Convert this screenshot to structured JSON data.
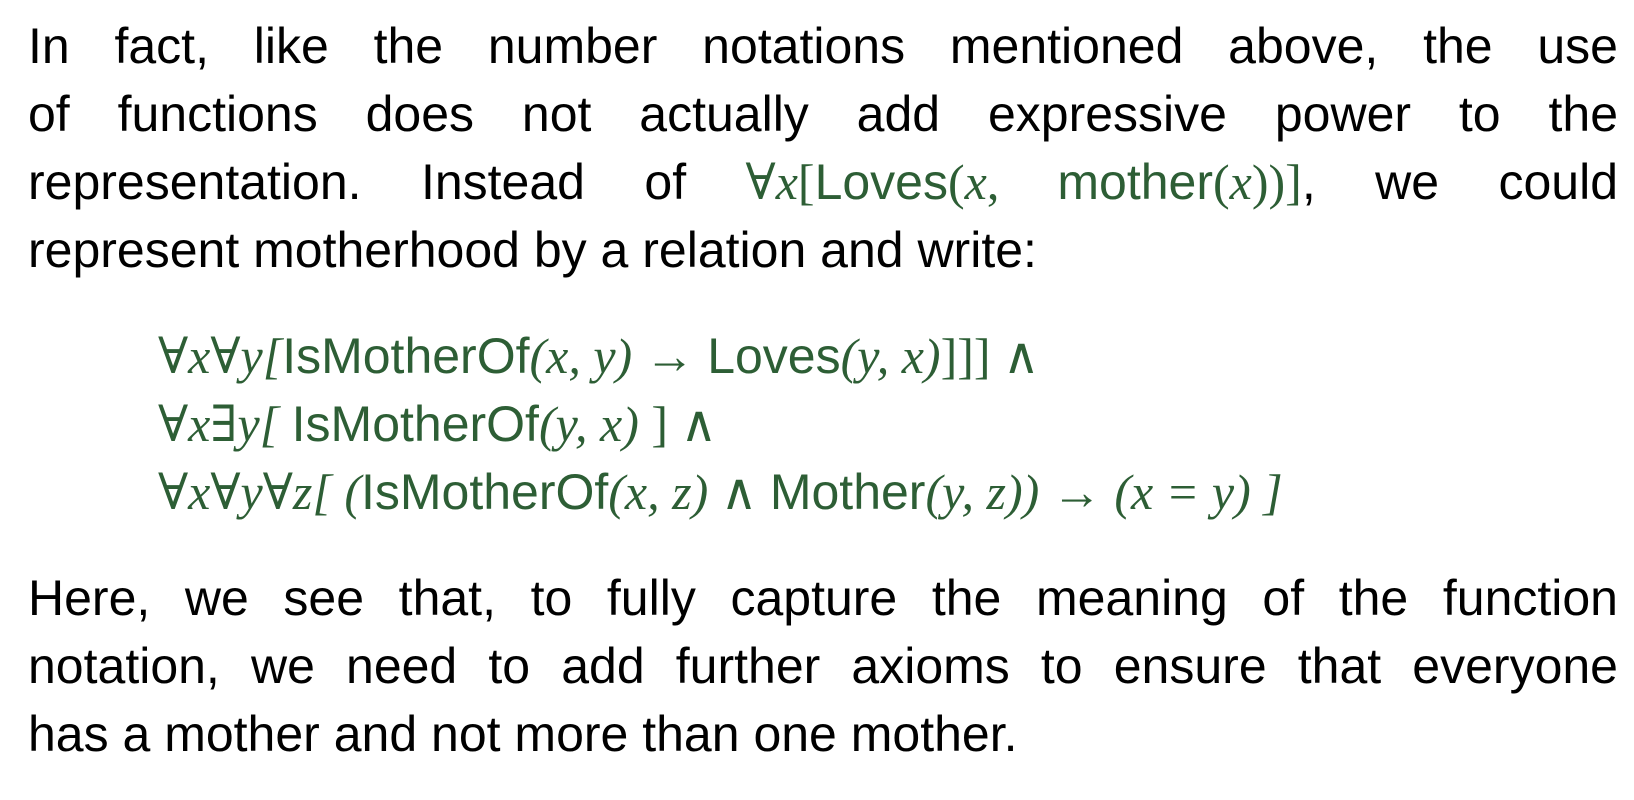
{
  "paragraph1": {
    "line1": "In fact, like the number notations mentioned above, the use",
    "line2": "of functions does not actually add expressive power to the",
    "line3_before": "representation.   Instead of ",
    "inline_formula": {
      "forall": "∀",
      "var_x": "x",
      "open": "[",
      "fn_loves": "Loves",
      "paren_open": "(",
      "arg_x": "x",
      "comma": ", ",
      "fn_mother": "mother",
      "inner_open": "(",
      "inner_x": "x",
      "close": "))]"
    },
    "line3_after": ", we could",
    "line4": "represent motherhood by a relation and write:"
  },
  "display": {
    "line1": {
      "quant": "∀x∀y[",
      "p1": "IsMotherOf",
      "a1": "(x, y)",
      "arrow": " → ",
      "p2": "Loves",
      "a2": "(y, x)",
      "end": "]]] ∧"
    },
    "line2": {
      "quant": "∀x∃y[ ",
      "p1": "IsMotherOf",
      "a1": "(y, x)",
      "end": " ] ∧"
    },
    "line3": {
      "quant": "∀x∀y∀z[ (",
      "p1": "IsMotherOf",
      "a1": "(x, z)",
      "and": " ∧ ",
      "p2": "Mother",
      "a2": "(y, z))",
      "arrow": " → ",
      "eq": "(x = y) ]"
    }
  },
  "paragraph2": {
    "line1": "Here, we see that, to fully capture the meaning of the function",
    "line2": "notation, we need to add further axioms to ensure that everyone",
    "line3": "has a mother and not more than one mother."
  },
  "colors": {
    "text": "#000000",
    "formula": "#2d5e35",
    "background": "#ffffff"
  }
}
